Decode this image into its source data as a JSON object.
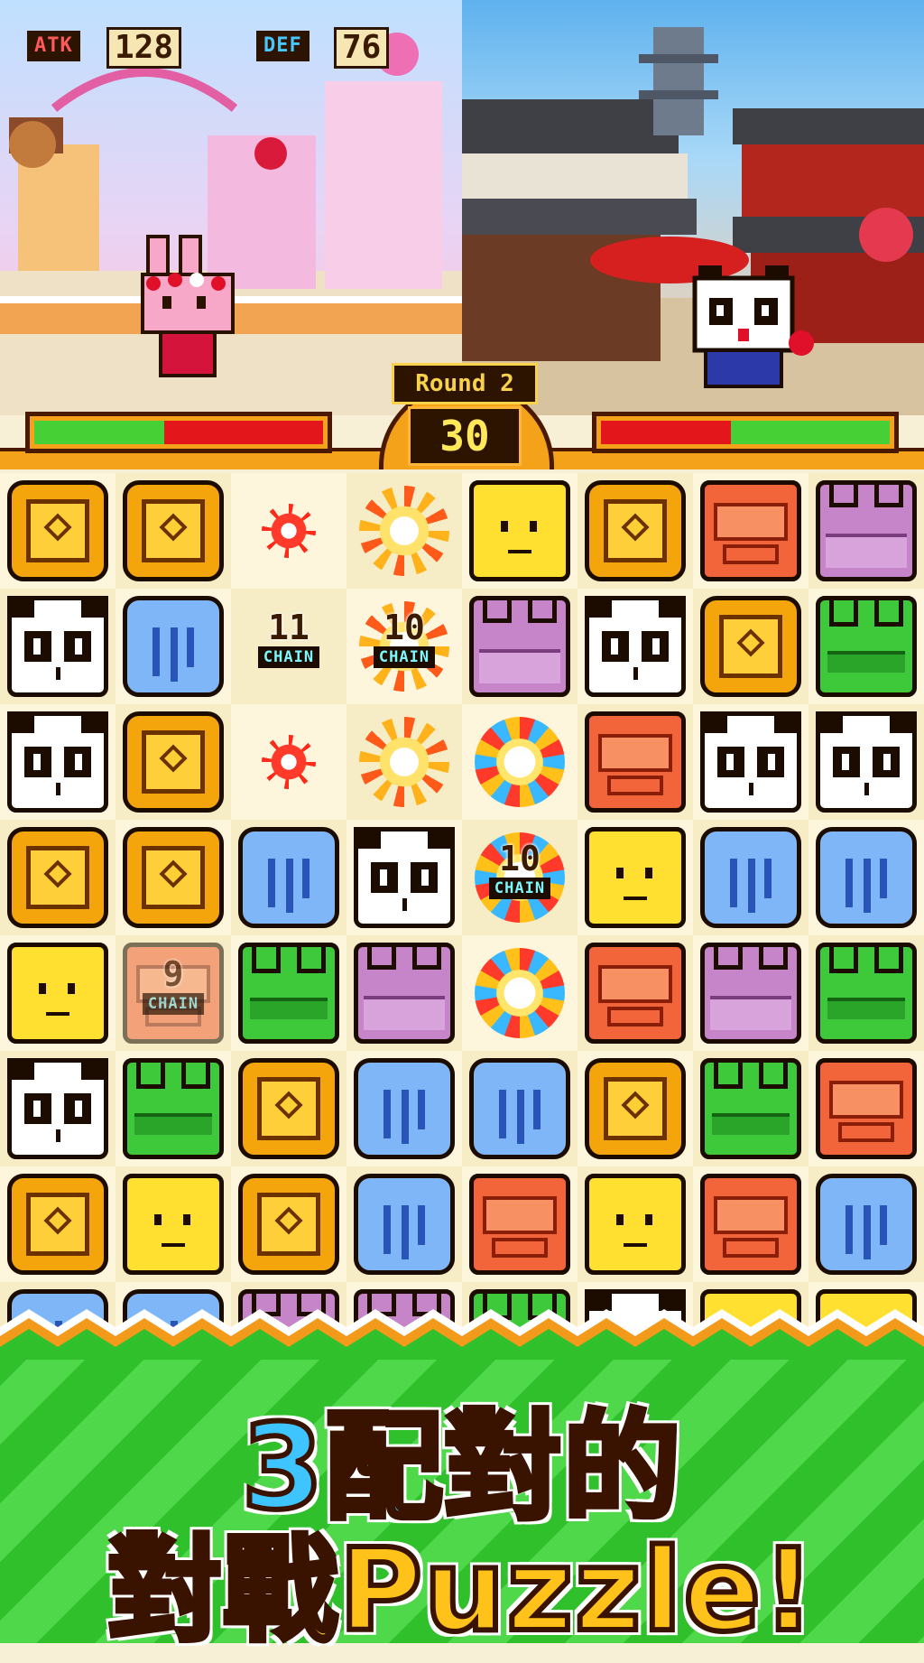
{
  "battle": {
    "atk_label": "ATK",
    "atk_value": "128",
    "def_label": "DEF",
    "def_value": "76",
    "round_label": "Round 2",
    "timer": "30",
    "player_hp_fraction": 0.45,
    "enemy_hp_fraction": 0.55,
    "player_character": "strawberry-bunny",
    "enemy_character": "panda"
  },
  "board": {
    "rows": [
      [
        "lion",
        "lion",
        "spark-small",
        "spark-big",
        "giraffe",
        "lion",
        "monkey",
        "hippo"
      ],
      [
        "panda",
        "elephant",
        "chain:11",
        "chain:10",
        "hippo",
        "panda",
        "lion",
        "frog"
      ],
      [
        "panda",
        "lion",
        "spark-small",
        "spark-big",
        "ring",
        "monkey",
        "panda",
        "panda"
      ],
      [
        "lion",
        "lion",
        "elephant",
        "panda",
        "chain-ring:10",
        "giraffe",
        "elephant",
        "elephant"
      ],
      [
        "giraffe",
        "chain-faded:9",
        "frog",
        "hippo",
        "ring",
        "monkey",
        "hippo",
        "frog"
      ],
      [
        "panda",
        "frog",
        "lion",
        "elephant",
        "elephant",
        "lion",
        "frog",
        "monkey"
      ],
      [
        "lion",
        "giraffe",
        "lion",
        "elephant",
        "monkey",
        "giraffe",
        "monkey",
        "elephant"
      ],
      [
        "elephant",
        "elephant",
        "hippo",
        "hippo",
        "frog",
        "panda",
        "giraffe",
        "giraffe"
      ]
    ],
    "chain_word": "CHAIN"
  },
  "piece_colors": {
    "lion": "#f5a50c",
    "panda": "#ffffff",
    "elephant": "#7fb6f7",
    "giraffe": "#ffe030",
    "monkey": "#f2643a",
    "hippo": "#c585c8",
    "frog": "#3ec93a"
  },
  "banner": {
    "line1": "3配對的",
    "line2": "對戰Puzzle!"
  }
}
